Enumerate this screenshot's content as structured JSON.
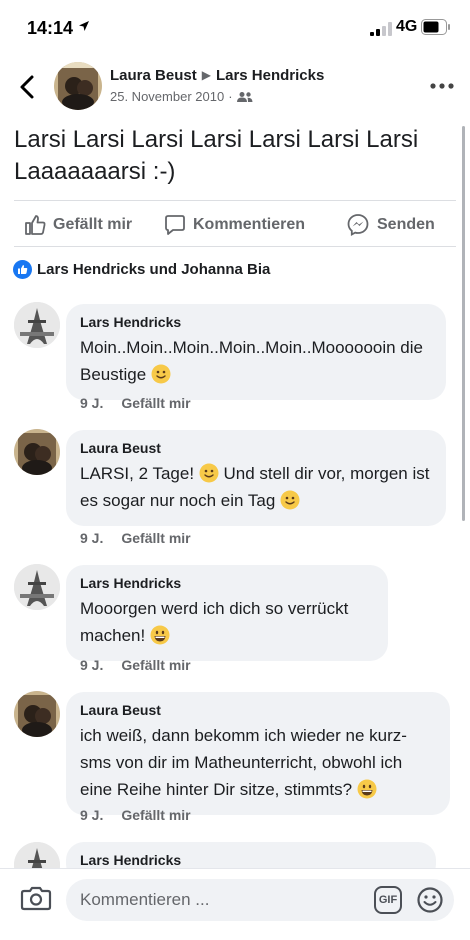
{
  "status_bar": {
    "time": "14:14",
    "network": "4G"
  },
  "post": {
    "author": "Laura Beust",
    "target": "Lars Hendricks",
    "date": "25. November 2010",
    "text": "Larsi Larsi Larsi Larsi Larsi Larsi Larsi Laaaaaaarsi :-)",
    "actions": {
      "like": "Gefällt mir",
      "comment": "Kommentieren",
      "send": "Senden"
    },
    "likes_summary": "Lars Hendricks und Johanna Bia"
  },
  "comments": [
    {
      "author": "Lars Hendricks",
      "text": "Moin..Moin..Moin..Moin..Moin..Mooooooin die Beustige",
      "emoji": "slight-smile",
      "age": "9 J.",
      "like": "Gefällt mir"
    },
    {
      "author": "Laura Beust",
      "text_a": "LARSI, 2 Tage!",
      "text_b": "Und stell dir vor, morgen ist es sogar nur noch ein Tag",
      "emoji": "slight-smile",
      "age": "9 J.",
      "like": "Gefällt mir"
    },
    {
      "author": "Lars Hendricks",
      "text": "Mooorgen werd ich dich so verrückt machen!",
      "emoji": "grin",
      "age": "9 J.",
      "like": "Gefällt mir"
    },
    {
      "author": "Laura Beust",
      "text": "ich weiß, dann bekomm ich wieder ne kurz-sms von dir im Matheunterricht, obwohl ich eine Reihe hinter Dir sitze, stimmts?",
      "emoji": "grin",
      "age": "9 J.",
      "like": "Gefällt mir"
    },
    {
      "author": "Lars Hendricks"
    }
  ],
  "composer": {
    "placeholder": "Kommentieren ...",
    "gif_label": "GIF"
  },
  "colors": {
    "accent": "#1877f2",
    "bubble": "#f0f2f5",
    "secondary_text": "#65676b",
    "emoji_yellow": "#f7c948"
  }
}
